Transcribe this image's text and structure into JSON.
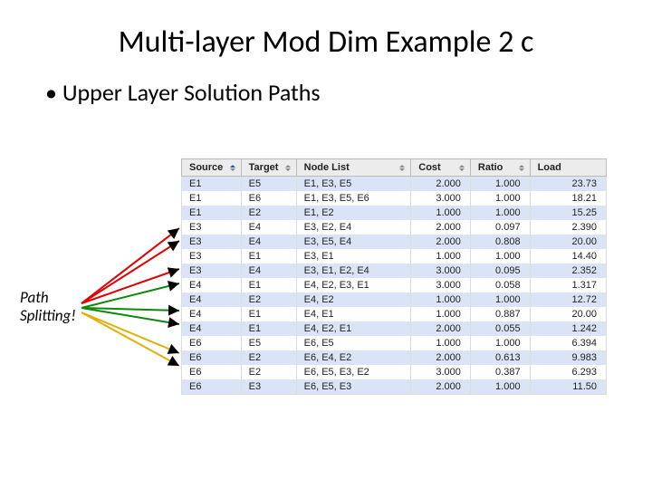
{
  "title": "Multi-layer Mod Dim Example 2 c",
  "bullet": "Upper Layer Solution Paths",
  "annotation": {
    "line1": "Path",
    "line2": "Splitting!"
  },
  "columns": [
    {
      "label": "Source",
      "sort": "asc"
    },
    {
      "label": "Target",
      "sort": "both"
    },
    {
      "label": "Node List",
      "sort": "both"
    },
    {
      "label": "Cost",
      "sort": "both"
    },
    {
      "label": "Ratio",
      "sort": "both"
    },
    {
      "label": "Load",
      "sort": ""
    }
  ],
  "rows": [
    {
      "source": "E1",
      "target": "E5",
      "nodelist": "E1, E3, E5",
      "cost": "2.000",
      "ratio": "1.000",
      "load": "23.73"
    },
    {
      "source": "E1",
      "target": "E6",
      "nodelist": "E1, E3, E5, E6",
      "cost": "3.000",
      "ratio": "1.000",
      "load": "18.21"
    },
    {
      "source": "E1",
      "target": "E2",
      "nodelist": "E1, E2",
      "cost": "1.000",
      "ratio": "1.000",
      "load": "15.25"
    },
    {
      "source": "E3",
      "target": "E4",
      "nodelist": "E3, E2, E4",
      "cost": "2.000",
      "ratio": "0.097",
      "load": "2.390"
    },
    {
      "source": "E3",
      "target": "E4",
      "nodelist": "E3, E5, E4",
      "cost": "2.000",
      "ratio": "0.808",
      "load": "20.00"
    },
    {
      "source": "E3",
      "target": "E1",
      "nodelist": "E3, E1",
      "cost": "1.000",
      "ratio": "1.000",
      "load": "14.40"
    },
    {
      "source": "E3",
      "target": "E4",
      "nodelist": "E3, E1, E2, E4",
      "cost": "3.000",
      "ratio": "0.095",
      "load": "2.352"
    },
    {
      "source": "E4",
      "target": "E1",
      "nodelist": "E4, E2, E3, E1",
      "cost": "3.000",
      "ratio": "0.058",
      "load": "1.317"
    },
    {
      "source": "E4",
      "target": "E2",
      "nodelist": "E4, E2",
      "cost": "1.000",
      "ratio": "1.000",
      "load": "12.72"
    },
    {
      "source": "E4",
      "target": "E1",
      "nodelist": "E4, E1",
      "cost": "1.000",
      "ratio": "0.887",
      "load": "20.00"
    },
    {
      "source": "E4",
      "target": "E1",
      "nodelist": "E4, E2, E1",
      "cost": "2.000",
      "ratio": "0.055",
      "load": "1.242"
    },
    {
      "source": "E6",
      "target": "E5",
      "nodelist": "E6, E5",
      "cost": "1.000",
      "ratio": "1.000",
      "load": "6.394"
    },
    {
      "source": "E6",
      "target": "E2",
      "nodelist": "E6, E4, E2",
      "cost": "2.000",
      "ratio": "0.613",
      "load": "9.983"
    },
    {
      "source": "E6",
      "target": "E2",
      "nodelist": "E6, E5, E3, E2",
      "cost": "3.000",
      "ratio": "0.387",
      "load": "6.293"
    },
    {
      "source": "E6",
      "target": "E3",
      "nodelist": "E6, E5, E3",
      "cost": "2.000",
      "ratio": "1.000",
      "load": "11.50"
    }
  ],
  "chart_data": {
    "type": "table",
    "title": "Upper Layer Solution Paths",
    "columns": [
      "Source",
      "Target",
      "Node List",
      "Cost",
      "Ratio",
      "Load"
    ],
    "rows": [
      [
        "E1",
        "E5",
        "E1, E3, E5",
        2.0,
        1.0,
        23.73
      ],
      [
        "E1",
        "E6",
        "E1, E3, E5, E6",
        3.0,
        1.0,
        18.21
      ],
      [
        "E1",
        "E2",
        "E1, E2",
        1.0,
        1.0,
        15.25
      ],
      [
        "E3",
        "E4",
        "E3, E2, E4",
        2.0,
        0.097,
        2.39
      ],
      [
        "E3",
        "E4",
        "E3, E5, E4",
        2.0,
        0.808,
        20.0
      ],
      [
        "E3",
        "E1",
        "E3, E1",
        1.0,
        1.0,
        14.4
      ],
      [
        "E3",
        "E4",
        "E3, E1, E2, E4",
        3.0,
        0.095,
        2.352
      ],
      [
        "E4",
        "E1",
        "E4, E2, E3, E1",
        3.0,
        0.058,
        1.317
      ],
      [
        "E4",
        "E2",
        "E4, E2",
        1.0,
        1.0,
        12.72
      ],
      [
        "E4",
        "E1",
        "E4, E1",
        1.0,
        0.887,
        20.0
      ],
      [
        "E4",
        "E1",
        "E4, E2, E1",
        2.0,
        0.055,
        1.242
      ],
      [
        "E6",
        "E5",
        "E6, E5",
        1.0,
        1.0,
        6.394
      ],
      [
        "E6",
        "E2",
        "E6, E4, E2",
        2.0,
        0.613,
        9.983
      ],
      [
        "E6",
        "E2",
        "E6, E5, E3, E2",
        3.0,
        0.387,
        6.293
      ],
      [
        "E6",
        "E3",
        "E6, E5, E3",
        2.0,
        1.0,
        11.5
      ]
    ]
  }
}
